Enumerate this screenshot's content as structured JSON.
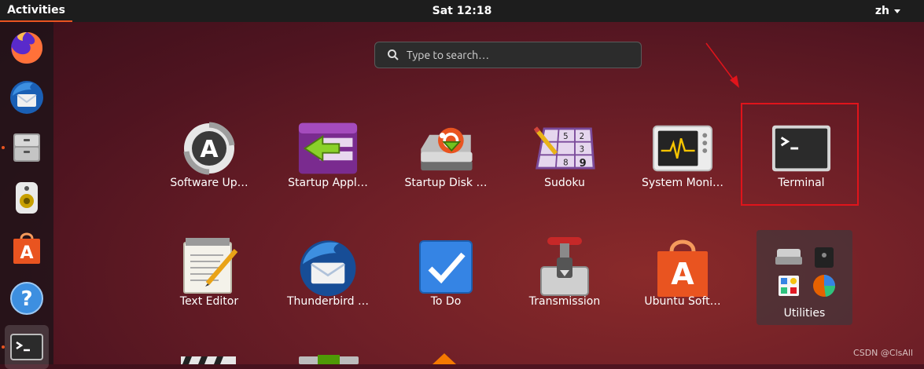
{
  "topbar": {
    "activities": "Activities",
    "clock": "Sat 12:18",
    "language": "zh"
  },
  "search": {
    "placeholder": "Type to search…"
  },
  "apps_row1": [
    {
      "label": "Software Up…",
      "icon": "software-updater-icon"
    },
    {
      "label": "Startup Appl…",
      "icon": "startup-applications-icon"
    },
    {
      "label": "Startup Disk …",
      "icon": "startup-disk-creator-icon"
    },
    {
      "label": "Sudoku",
      "icon": "sudoku-icon"
    },
    {
      "label": "System Moni…",
      "icon": "system-monitor-icon"
    },
    {
      "label": "Terminal",
      "icon": "terminal-icon"
    }
  ],
  "apps_row2": [
    {
      "label": "Text Editor",
      "icon": "text-editor-icon"
    },
    {
      "label": "Thunderbird …",
      "icon": "thunderbird-icon"
    },
    {
      "label": "To Do",
      "icon": "todo-icon"
    },
    {
      "label": "Transmission",
      "icon": "transmission-icon"
    },
    {
      "label": "Ubuntu Soft…",
      "icon": "ubuntu-software-icon"
    },
    {
      "label": "Utilities",
      "icon": "utilities-folder-icon"
    }
  ],
  "sudoku_digits": [
    "5",
    "2",
    "3",
    "8",
    "9"
  ],
  "dock": [
    "firefox-icon",
    "thunderbird-icon",
    "files-icon",
    "rhythmbox-icon",
    "ubuntu-software-icon",
    "help-icon",
    "terminal-icon"
  ],
  "watermark": "CSDN @ClsAll",
  "colors": {
    "accent": "#e95420",
    "highlight": "#e0141b"
  }
}
